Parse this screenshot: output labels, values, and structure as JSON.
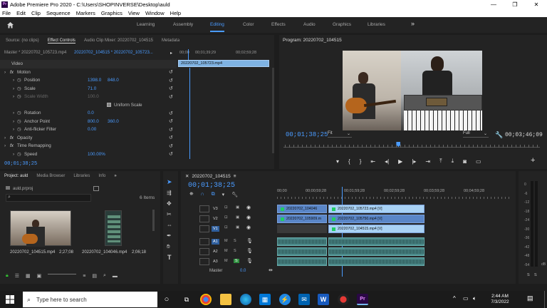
{
  "titlebar": {
    "title": "Adobe Premiere Pro 2020 - C:\\Users\\SHOPINVERSE\\Desktop\\auld",
    "min": "—",
    "max": "❐",
    "close": "✕",
    "app_icon": "Pr"
  },
  "menubar": {
    "items": [
      "File",
      "Edit",
      "Clip",
      "Sequence",
      "Markers",
      "Graphics",
      "View",
      "Window",
      "Help"
    ]
  },
  "workspaces": {
    "items": [
      "Learning",
      "Assembly",
      "Editing",
      "Color",
      "Effects",
      "Audio",
      "Graphics",
      "Libraries"
    ],
    "active": "Editing",
    "more": "»"
  },
  "source_panel": {
    "tabs": [
      "Source: (no clips)",
      "Effect Controls",
      "Audio Clip Mixer: 20220702_104515",
      "Metadata"
    ],
    "active_tab": "Effect Controls",
    "master_label": "Master * 20220702_105723.mp4",
    "sequence_label": "20220702_104515 * 20220702_105723...",
    "ruler_times": [
      "00;00",
      "00;01;39;29",
      "00;02;59;28"
    ],
    "clip_name": "20220702_105723.mp4",
    "rows": [
      {
        "label": "Video",
        "indent": 0
      },
      {
        "label": "Motion",
        "indent": 1,
        "fx": true
      },
      {
        "label": "Position",
        "indent": 3,
        "v1": "1398.0",
        "v2": "848.0"
      },
      {
        "label": "Scale",
        "indent": 3,
        "v1": "71.0"
      },
      {
        "label": "Scale Width",
        "indent": 3,
        "v1": "100.0",
        "dim": true
      },
      {
        "label": "Uniform Scale",
        "indent": 7,
        "checkbox": true
      },
      {
        "label": "Rotation",
        "indent": 3,
        "v1": "0.0"
      },
      {
        "label": "Anchor Point",
        "indent": 3,
        "v1": "800.0",
        "v2": "360.0"
      },
      {
        "label": "Anti-flicker Filter",
        "indent": 3,
        "v1": "0.00"
      },
      {
        "label": "Opacity",
        "indent": 1,
        "fx": true
      },
      {
        "label": "Time Remapping",
        "indent": 1,
        "fx": true
      },
      {
        "label": "Speed",
        "indent": 3,
        "v1": "100.00%"
      }
    ],
    "timecode": "00;01;38;25"
  },
  "program": {
    "title": "Program: 20220702_104515",
    "timecode": "00;01;38;25",
    "fit": "Fit",
    "quality": "Full",
    "duration": "00;03;46;09",
    "playhead_fraction": 0.44
  },
  "project": {
    "tabs": [
      "Project: auld",
      "Media Browser",
      "Libraries",
      "Info"
    ],
    "file": "auld.prproj",
    "item_count": "6 Items",
    "items": [
      {
        "name": "20220702_104515.mp4",
        "duration": "2;27;08"
      },
      {
        "name": "20220702_104046.mp4",
        "duration": "2;06;18"
      }
    ]
  },
  "timeline": {
    "sequence": "20220702_104515",
    "timecode": "00;01;38;25",
    "ruler": [
      "00;00",
      "00;00;59;28",
      "00;01;59;28",
      "00;02;59;28",
      "00;03;59;28",
      "00;04;59;28"
    ],
    "tracks_v": [
      "V3",
      "V2",
      "V1"
    ],
    "tracks_a": [
      "A1",
      "A2",
      "A3"
    ],
    "master_label": "Master",
    "master_value": "0.0",
    "clips": [
      {
        "track": "V3",
        "name": "20220702_104046",
        "color": "blue"
      },
      {
        "track": "V3",
        "name": "20220702_105723.mp4 [V]",
        "color": "light"
      },
      {
        "track": "V2",
        "name": "20220702_105909.m",
        "color": "blue"
      },
      {
        "track": "V2",
        "name": "20220702_105750.mp4 [V]",
        "color": "blue"
      },
      {
        "track": "V1",
        "name": "20220702_104515.mp4 [V]",
        "color": "light"
      }
    ]
  },
  "meter": {
    "scale": [
      "0",
      "-6",
      "-12",
      "-18",
      "-24",
      "-30",
      "-36",
      "-42",
      "-48",
      "-54"
    ],
    "db": "dB",
    "s_labels": [
      "S",
      "S"
    ]
  },
  "taskbar": {
    "search_placeholder": "Type here to search",
    "time": "2:44 AM",
    "date": "7/3/2022"
  },
  "colors": {
    "accent": "#4a9bff",
    "clip_blue": "#5a86c8",
    "clip_light": "#a9d2f5",
    "audio_green": "#4c8c8c"
  }
}
